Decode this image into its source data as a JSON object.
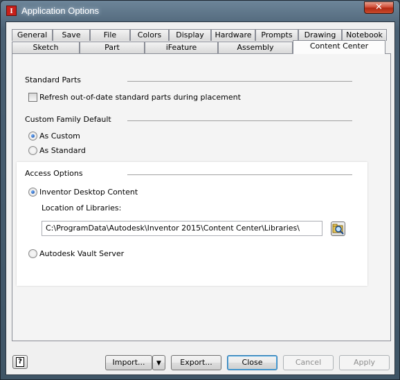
{
  "window": {
    "title": "Application Options",
    "close_glyph": "✕",
    "app_icon_letter": "I"
  },
  "tabs_back_row": [
    "General",
    "Save",
    "File",
    "Colors",
    "Display",
    "Hardware",
    "Prompts",
    "Drawing",
    "Notebook"
  ],
  "tabs_front_row": [
    "Sketch",
    "Part",
    "iFeature",
    "Assembly",
    "Content Center"
  ],
  "active_tab": "Content Center",
  "standard_parts": {
    "heading": "Standard Parts",
    "refresh_checkbox_label": "Refresh out-of-date standard parts during placement",
    "refresh_checked": false
  },
  "custom_family_default": {
    "heading": "Custom Family Default",
    "options": [
      "As Custom",
      "As Standard"
    ],
    "selected": "As Custom"
  },
  "access_options": {
    "heading": "Access Options",
    "desktop_label": "Inventor Desktop Content",
    "location_label": "Location of Libraries:",
    "location_value": "C:\\ProgramData\\Autodesk\\Inventor 2015\\Content Center\\Libraries\\",
    "vault_label": "Autodesk Vault Server",
    "selected": "Inventor Desktop Content"
  },
  "footer": {
    "help_glyph": "?",
    "import_label": "Import...",
    "export_label": "Export...",
    "close_label": "Close",
    "cancel_label": "Cancel",
    "apply_label": "Apply",
    "dropdown_glyph": "▼"
  },
  "colors": {
    "accent_radio": "#0b3d91",
    "highlight_panel": "#ffffff",
    "titlebar": "#4a6073",
    "close_button": "#c84a2c"
  }
}
